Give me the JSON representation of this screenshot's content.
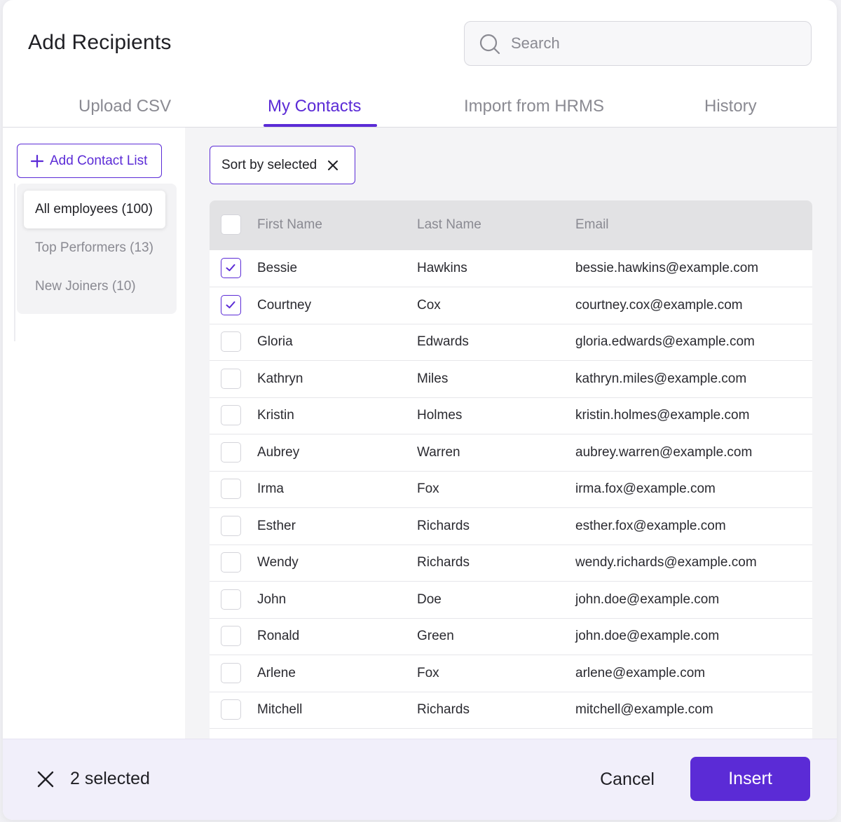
{
  "dialog": {
    "title": "Add Recipients"
  },
  "search": {
    "placeholder": "Search",
    "icon": "search-icon"
  },
  "tabs": [
    {
      "label": "Upload CSV",
      "active": false
    },
    {
      "label": "My Contacts",
      "active": true
    },
    {
      "label": "Import from HRMS",
      "active": false
    },
    {
      "label": "History",
      "active": false
    }
  ],
  "sidebar": {
    "add_button_label": "Add Contact List",
    "lists": [
      {
        "label": "All employees (100)",
        "active": true
      },
      {
        "label": "Top Performers (13)",
        "active": false
      },
      {
        "label": "New Joiners (10)",
        "active": false
      }
    ]
  },
  "filter": {
    "sort_chip_label": "Sort by selected"
  },
  "table": {
    "columns": [
      "First Name",
      "Last Name",
      "Email"
    ],
    "rows": [
      {
        "first": "Bessie",
        "last": "Hawkins",
        "email": "bessie.hawkins@example.com",
        "checked": true
      },
      {
        "first": "Courtney",
        "last": "Cox",
        "email": "courtney.cox@example.com",
        "checked": true
      },
      {
        "first": "Gloria",
        "last": "Edwards",
        "email": "gloria.edwards@example.com",
        "checked": false
      },
      {
        "first": "Kathryn",
        "last": "Miles",
        "email": "kathryn.miles@example.com",
        "checked": false
      },
      {
        "first": "Kristin",
        "last": "Holmes",
        "email": "kristin.holmes@example.com",
        "checked": false
      },
      {
        "first": "Aubrey",
        "last": "Warren",
        "email": "aubrey.warren@example.com",
        "checked": false
      },
      {
        "first": "Irma",
        "last": "Fox",
        "email": "irma.fox@example.com",
        "checked": false
      },
      {
        "first": "Esther",
        "last": "Richards",
        "email": "esther.fox@example.com",
        "checked": false
      },
      {
        "first": "Wendy",
        "last": "Richards",
        "email": "wendy.richards@example.com",
        "checked": false
      },
      {
        "first": "John",
        "last": "Doe",
        "email": "john.doe@example.com",
        "checked": false
      },
      {
        "first": "Ronald",
        "last": "Green",
        "email": "john.doe@example.com",
        "checked": false
      },
      {
        "first": "Arlene",
        "last": "Fox",
        "email": "arlene@example.com",
        "checked": false
      },
      {
        "first": "Mitchell",
        "last": "Richards",
        "email": "mitchell@example.com",
        "checked": false
      }
    ]
  },
  "footer": {
    "selected_text": "2 selected",
    "cancel_label": "Cancel",
    "insert_label": "Insert"
  },
  "colors": {
    "accent": "#5b2bd6",
    "footer_bg": "#f1effa",
    "header_bg": "#e2e2e4"
  }
}
